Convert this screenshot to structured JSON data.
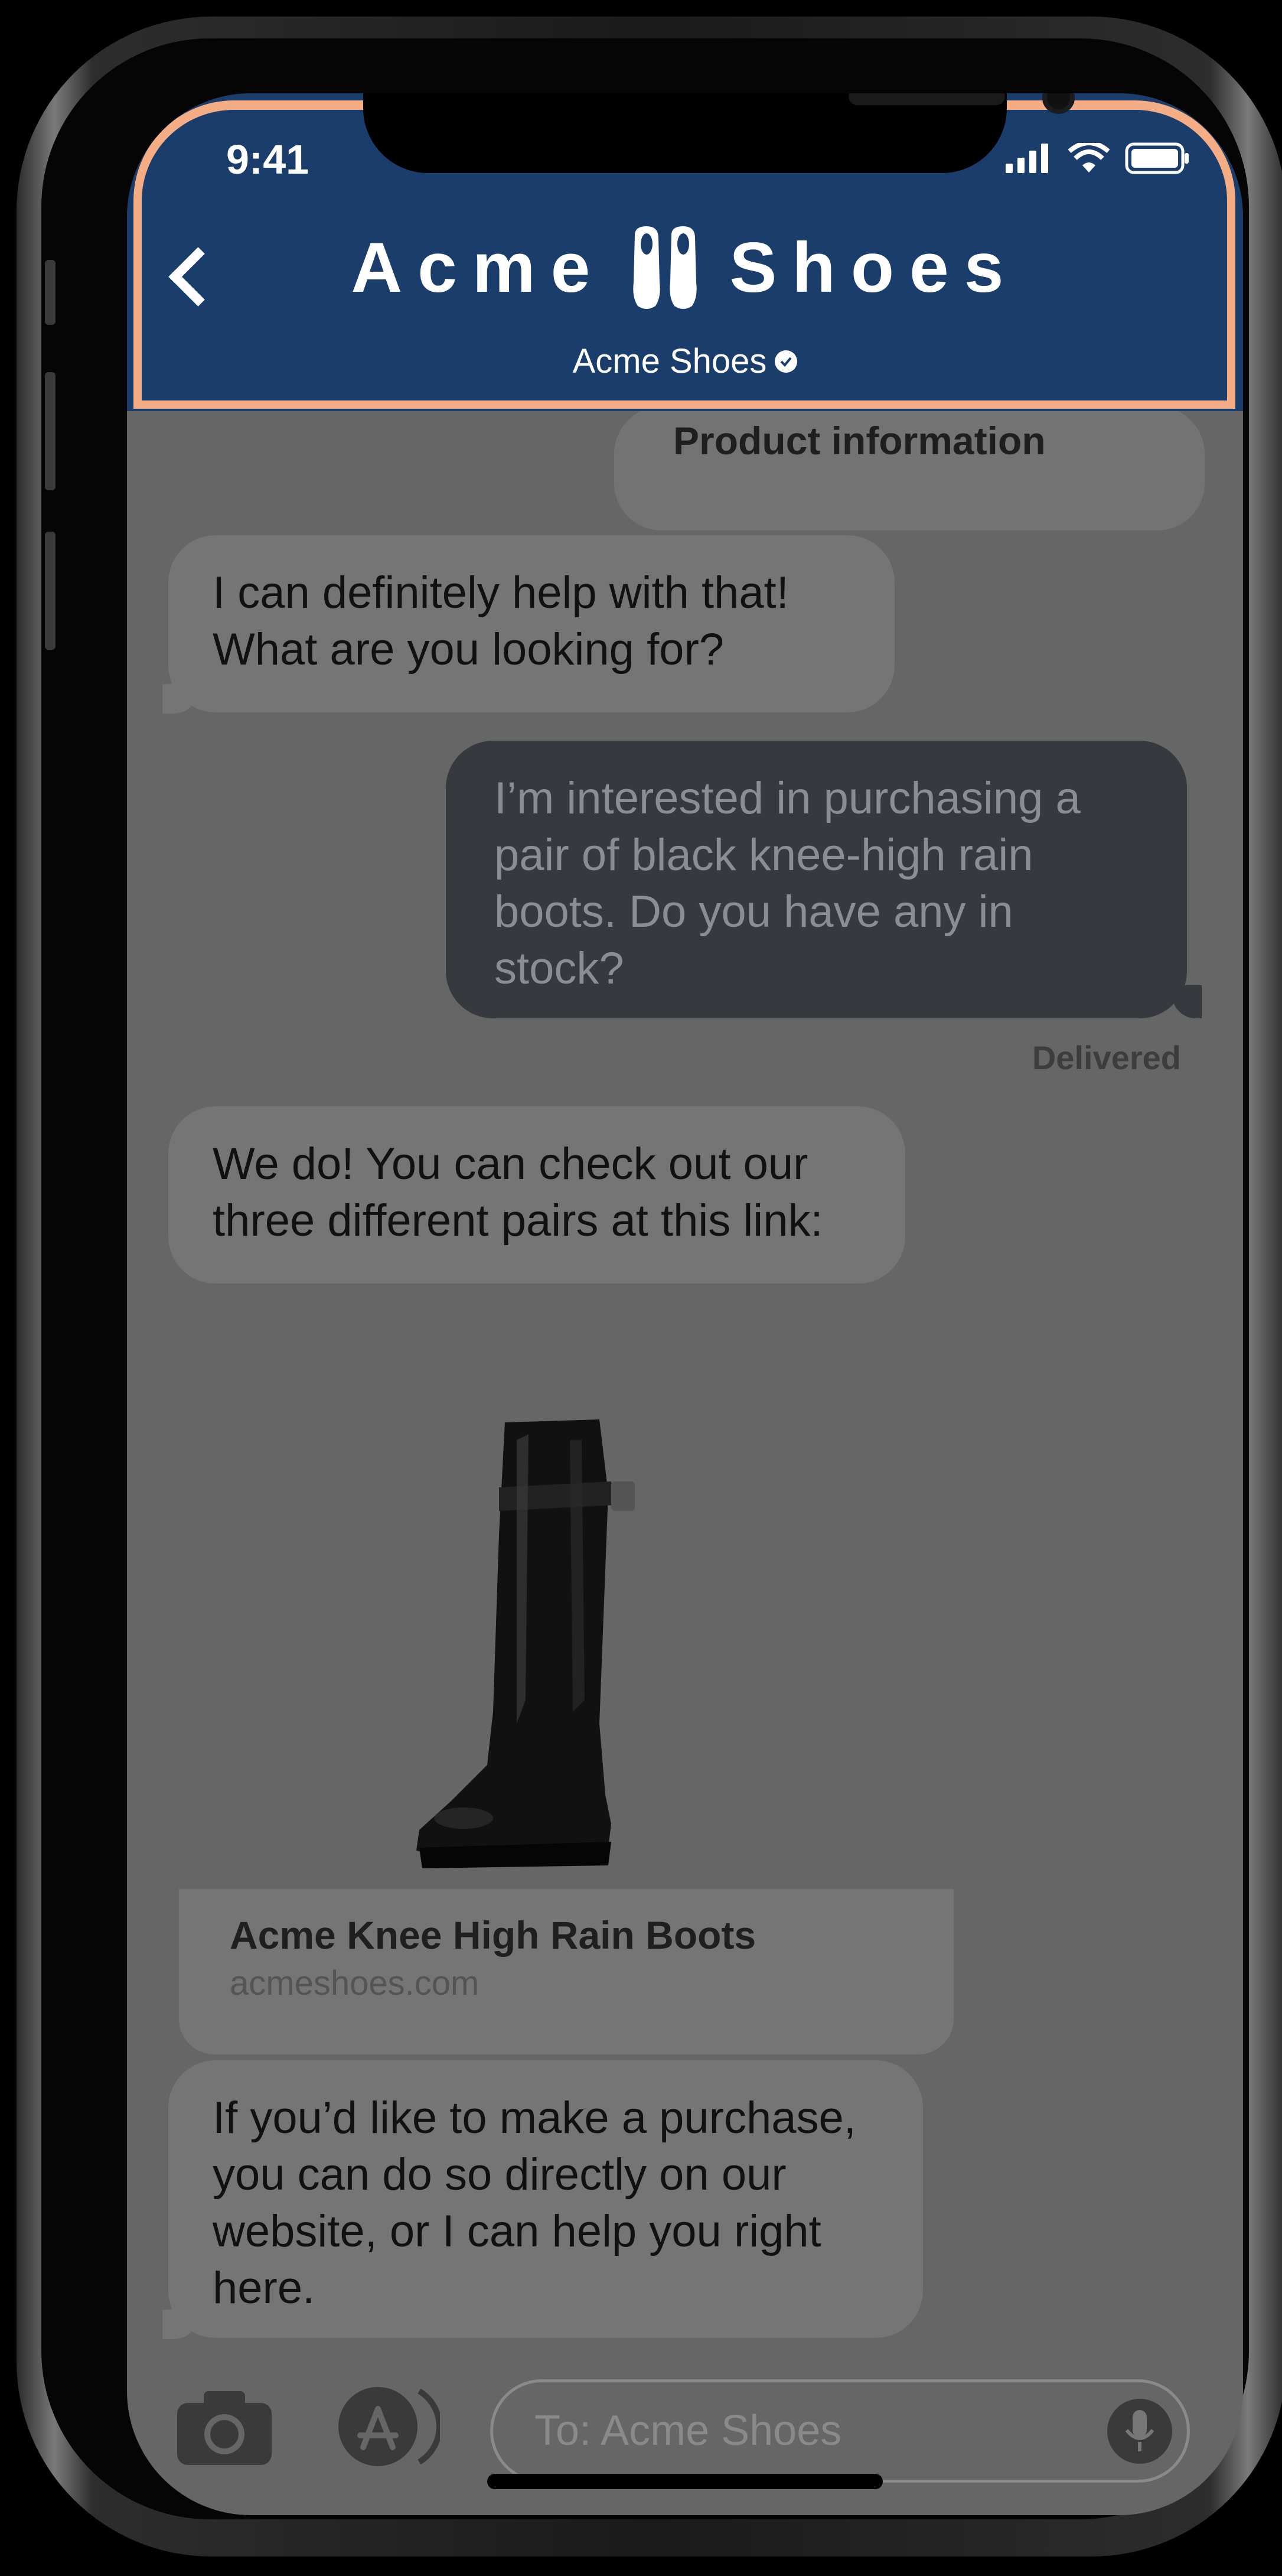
{
  "status_bar": {
    "time": "9:41"
  },
  "header": {
    "brand_left": "Acme",
    "brand_right": "Shoes",
    "subtitle": "Acme Shoes"
  },
  "messages": [
    {
      "side": "right",
      "text": "Product information"
    },
    {
      "side": "left",
      "text": "I can definitely help with that! What are you looking for?"
    },
    {
      "side": "right",
      "text": "I’m interested in purchasing a pair of black knee-high rain boots. Do you have any in stock?"
    },
    {
      "side": "left",
      "text": "We do! You can check out our three different pairs at this link:"
    },
    {
      "side": "left",
      "text": "If you’d like to make a purchase, you can do so directly on our website, or I can help you right here."
    }
  ],
  "delivered_label": "Delivered",
  "link_preview": {
    "title": "Acme Knee High Rain Boots",
    "domain": "acmeshoes.com"
  },
  "input": {
    "placeholder": "To: Acme Shoes"
  },
  "colors": {
    "header_bg": "#1b3d6b",
    "header_border": "#f4ad84",
    "overlay": "#666666"
  }
}
